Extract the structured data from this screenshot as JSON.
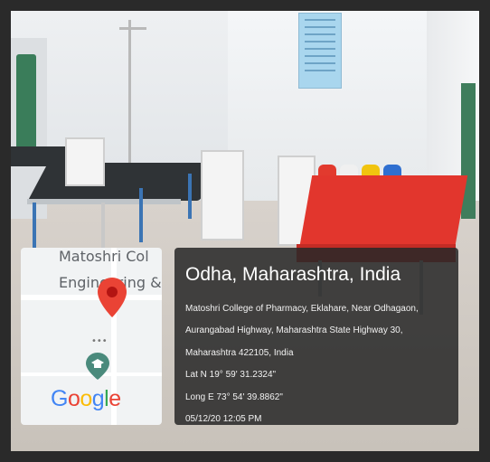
{
  "map": {
    "place_line1": "Matoshri Col",
    "place_line2": "Engineering &",
    "logo": "Google",
    "logo_colors": [
      "#4285F4",
      "#EA4335",
      "#FBBC05",
      "#4285F4",
      "#34A853",
      "#EA4335"
    ],
    "pin_color": "#EA4335",
    "pin_icon": "map-pin-icon",
    "poi_icon": "graduation-cap-icon"
  },
  "geotag": {
    "title": "Odha, Maharashtra, India",
    "address_line1": "Matoshri College of Pharmacy, Eklahare, Near Odhagaon,",
    "address_line2": "Aurangabad Highway, Maharashtra State Highway 30,",
    "address_line3": "Maharashtra 422105, India",
    "latitude": "Lat N 19° 59' 31.2324\"",
    "longitude": "Long E 73° 54' 39.8862\"",
    "datetime": "05/12/20 12:05 PM"
  }
}
